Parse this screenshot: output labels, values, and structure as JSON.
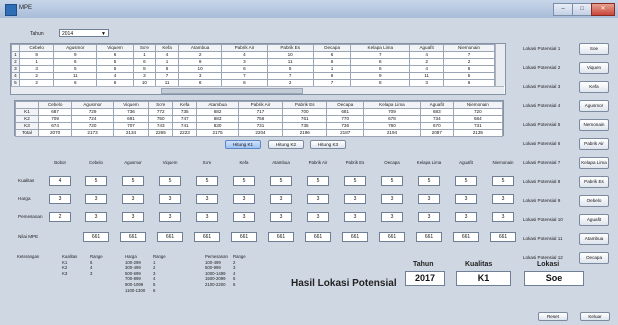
{
  "window": {
    "title": "MPE",
    "controls": [
      "–",
      "□",
      "✕"
    ]
  },
  "tahun": {
    "label": "Tahun",
    "value": "2014"
  },
  "top_table": {
    "columns": [
      "Cebelo",
      "Agusmor",
      "Viquem",
      "So'e",
      "Kefa",
      "Atambua",
      "Pabrik Air",
      "Pabrik Es",
      "Oecapa",
      "Kelapa Lima",
      "Aguafit",
      "Niemonain"
    ],
    "rows": [
      {
        "label": "1",
        "cells": [
          "8",
          "9",
          "6",
          "1",
          "4",
          "2",
          "4",
          "10",
          "6",
          "7",
          "4",
          "7"
        ]
      },
      {
        "label": "2",
        "cells": [
          "1",
          "6",
          "5",
          "6",
          "1",
          "9",
          "3",
          "11",
          "6",
          "6",
          "2",
          "2"
        ]
      },
      {
        "label": "3",
        "cells": [
          "3",
          "5",
          "5",
          "8",
          "6",
          "10",
          "6",
          "5",
          "1",
          "6",
          "4",
          "6"
        ]
      },
      {
        "label": "4",
        "cells": [
          "2",
          "11",
          "4",
          "3",
          "7",
          "3",
          "7",
          "7",
          "6",
          "9",
          "11",
          "5"
        ]
      },
      {
        "label": "5",
        "cells": [
          "2",
          "6",
          "6",
          "10",
          "11",
          "8",
          "6",
          "2",
          "7",
          "8",
          "3",
          "6"
        ]
      }
    ]
  },
  "bottom_table": {
    "columns": [
      "Cebelo",
      "Agusmor",
      "Viquem",
      "So'e",
      "Kefa",
      "Atambua",
      "Pabrik Air",
      "Pabrik Es",
      "Oecapa",
      "Kelapa Lima",
      "Aguafit",
      "Niemonain"
    ],
    "rows": [
      {
        "label": "K1",
        "cells": [
          "687",
          "729",
          "736",
          "772",
          "735",
          "682",
          "717",
          "700",
          "681",
          "709",
          "683",
          "720"
        ]
      },
      {
        "label": "K2",
        "cells": [
          "709",
          "724",
          "691",
          "750",
          "747",
          "683",
          "756",
          "761",
          "770",
          "678",
          "734",
          "684"
        ]
      },
      {
        "label": "K3",
        "cells": [
          "674",
          "720",
          "707",
          "743",
          "741",
          "830",
          "731",
          "735",
          "736",
          "760",
          "670",
          "731"
        ]
      },
      {
        "label": "Total",
        "cells": [
          "2070",
          "2173",
          "2134",
          "2265",
          "2223",
          "2175",
          "2204",
          "2196",
          "2187",
          "2194",
          "2087",
          "2135"
        ]
      }
    ]
  },
  "hitung_buttons": [
    "Hitung K1",
    "Hitung K2",
    "Hitung K3"
  ],
  "criteria": {
    "columns": [
      "Bobot",
      "Cebelo",
      "Agusmor",
      "Viquem",
      "So'e",
      "Kefa",
      "Atambua",
      "Pabrik Air",
      "Pabrik Es",
      "Oecapa",
      "Kelapa Lima",
      "Aguafit",
      "Niemonain"
    ],
    "rows": [
      {
        "label": "Kualitas",
        "cells": [
          "4",
          "5",
          "5",
          "5",
          "5",
          "5",
          "5",
          "5",
          "5",
          "5",
          "5",
          "5",
          "5"
        ]
      },
      {
        "label": "Harga",
        "cells": [
          "3",
          "3",
          "3",
          "3",
          "3",
          "3",
          "3",
          "3",
          "3",
          "3",
          "3",
          "3",
          "3"
        ]
      },
      {
        "label": "Pemesanan",
        "cells": [
          "2",
          "3",
          "3",
          "3",
          "3",
          "3",
          "3",
          "3",
          "3",
          "3",
          "3",
          "3",
          "3"
        ]
      }
    ],
    "nilai_label": "Nilai MPE",
    "nilai_cells": [
      "661",
      "661",
      "661",
      "661",
      "661",
      "661",
      "661",
      "661",
      "661",
      "661",
      "661",
      "661"
    ]
  },
  "keterangan": {
    "label": "Keterangan",
    "kualitas_header": [
      "Kualitas",
      "Range"
    ],
    "kualitas_rows": [
      [
        "K1",
        "5"
      ],
      [
        "K2",
        "4"
      ],
      [
        "K3",
        "3"
      ]
    ],
    "harga_header": [
      "Harga",
      "Range"
    ],
    "harga_rows": [
      [
        "100-299",
        "1"
      ],
      [
        "300-499",
        "2"
      ],
      [
        "500-699",
        "3"
      ],
      [
        "700-899",
        "4"
      ],
      [
        "900-1099",
        "5"
      ],
      [
        "1100-1300",
        "6"
      ]
    ],
    "pemesanan_header": [
      "Pemesanan",
      "Range"
    ],
    "pemesanan_rows": [
      [
        "100-499",
        "2"
      ],
      [
        "500-999",
        "3"
      ],
      [
        "1000-1499",
        "4"
      ],
      [
        "1500-2099",
        "5"
      ],
      [
        "2100-2200",
        "6"
      ]
    ]
  },
  "result": {
    "heading": "Hasil Lokasi Potensial",
    "tahun_label": "Tahun",
    "tahun_value": "2017",
    "kualitas_label": "Kualitas",
    "kualitas_value": "K1",
    "lokasi_label": "Lokasi",
    "lokasi_value": "Soe"
  },
  "lokasi_potensial": [
    {
      "label": "Lokasi Potensial 1",
      "value": "Soe"
    },
    {
      "label": "Lokasi Potensial 2",
      "value": "Viquen"
    },
    {
      "label": "Lokasi Potensial 3",
      "value": "Kefa"
    },
    {
      "label": "Lokasi Potensial 4",
      "value": "Agusmor"
    },
    {
      "label": "Lokasi Potensial 5",
      "value": "Nemonain"
    },
    {
      "label": "Lokasi Potensial 6",
      "value": "Pabrik Air"
    },
    {
      "label": "Lokasi Potensial 7",
      "value": "Kelapa Lima"
    },
    {
      "label": "Lokasi Potensial 8",
      "value": "Pabrik Es"
    },
    {
      "label": "Lokasi Potensial 9",
      "value": "Oebelo"
    },
    {
      "label": "Lokasi Potensial 10",
      "value": "Aguafit"
    },
    {
      "label": "Lokasi Potensial 11",
      "value": "Atambua"
    },
    {
      "label": "Lokasi Potensial 12",
      "value": "Oecapa"
    }
  ],
  "footer_buttons": {
    "reset": "Reset",
    "keluar": "Keluar"
  }
}
